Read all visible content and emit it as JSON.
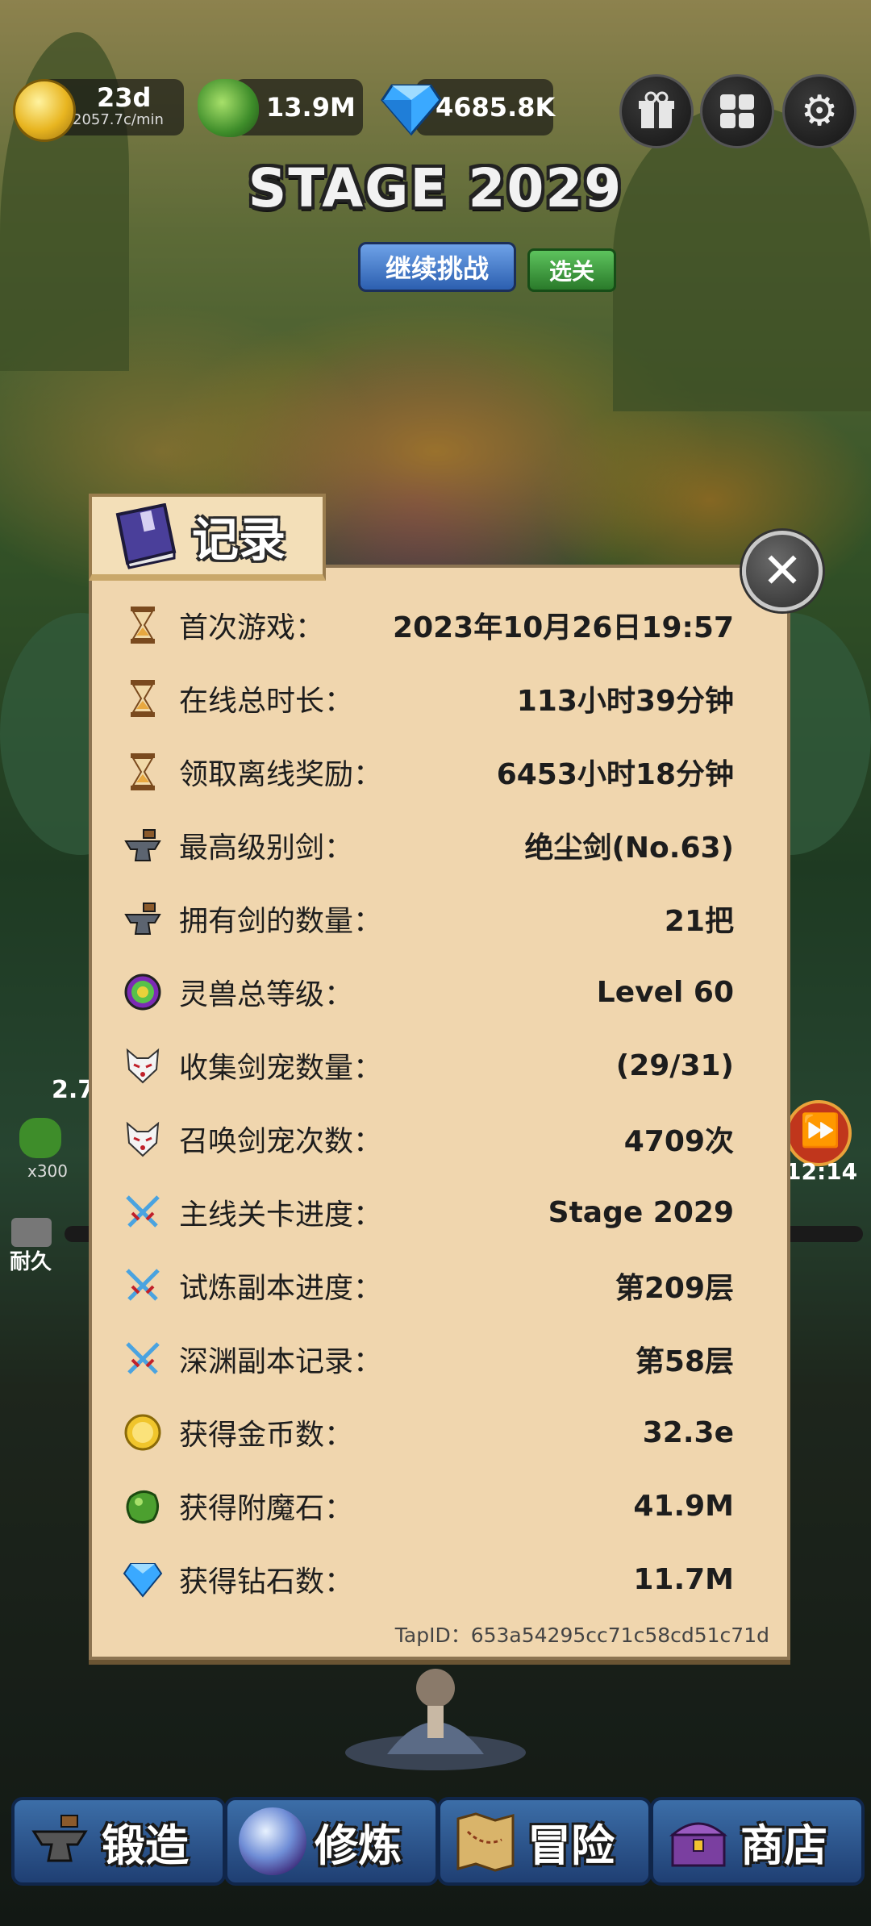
{
  "hud": {
    "gold_value": "23d",
    "gold_rate": "2057.7c/min",
    "stone_value": "13.9M",
    "diamond_value": "4685.8K",
    "gift_icon": "gift-icon",
    "grid_icon": "grid-icon",
    "settings_icon": "gear-icon"
  },
  "stage": {
    "title": "STAGE 2029",
    "continue_label": "继续挑战",
    "select_label": "选关"
  },
  "background": {
    "partial_value": "2.7",
    "multiplier": "x300",
    "durability_label": "耐久",
    "timer": "12:14"
  },
  "dialog": {
    "title": "记录",
    "rows": [
      {
        "icon": "hourglass-icon",
        "label": "首次游戏：",
        "value": "2023年10月26日19:57"
      },
      {
        "icon": "hourglass-icon",
        "label": "在线总时长：",
        "value": "113小时39分钟"
      },
      {
        "icon": "hourglass-icon",
        "label": "领取离线奖励：",
        "value": "6453小时18分钟"
      },
      {
        "icon": "anvil-icon",
        "label": "最高级别剑：",
        "value": "绝尘剑(No.63)"
      },
      {
        "icon": "anvil-icon",
        "label": "拥有剑的数量：",
        "value": "21把"
      },
      {
        "icon": "spirit-orb-icon",
        "label": "灵兽总等级：",
        "value": "Level 60"
      },
      {
        "icon": "fox-mask-icon",
        "label": "收集剑宠数量：",
        "value": "(29/31)"
      },
      {
        "icon": "fox-mask-icon",
        "label": "召唤剑宠次数：",
        "value": "4709次"
      },
      {
        "icon": "crossed-swords-icon",
        "label": "主线关卡进度：",
        "value": "Stage 2029"
      },
      {
        "icon": "crossed-swords-icon",
        "label": "试炼副本进度：",
        "value": "第209层"
      },
      {
        "icon": "crossed-swords-icon",
        "label": "深渊副本记录：",
        "value": "第58层"
      },
      {
        "icon": "gold-coin-icon",
        "label": "获得金币数：",
        "value": "32.3e"
      },
      {
        "icon": "enchant-stone-icon",
        "label": "获得附魔石：",
        "value": "41.9M"
      },
      {
        "icon": "diamond-icon",
        "label": "获得钻石数：",
        "value": "11.7M"
      }
    ],
    "tap_id": "TapID：653a54295cc71c58cd51c71d"
  },
  "nav": {
    "forge": "锻造",
    "cultivate": "修炼",
    "adventure": "冒险",
    "shop": "商店"
  },
  "colors": {
    "panel_bg": "#f0d6ae",
    "nav_blue": "#2c5a94",
    "continue_blue": "#2c5fb0",
    "select_green": "#2a7a2a"
  }
}
